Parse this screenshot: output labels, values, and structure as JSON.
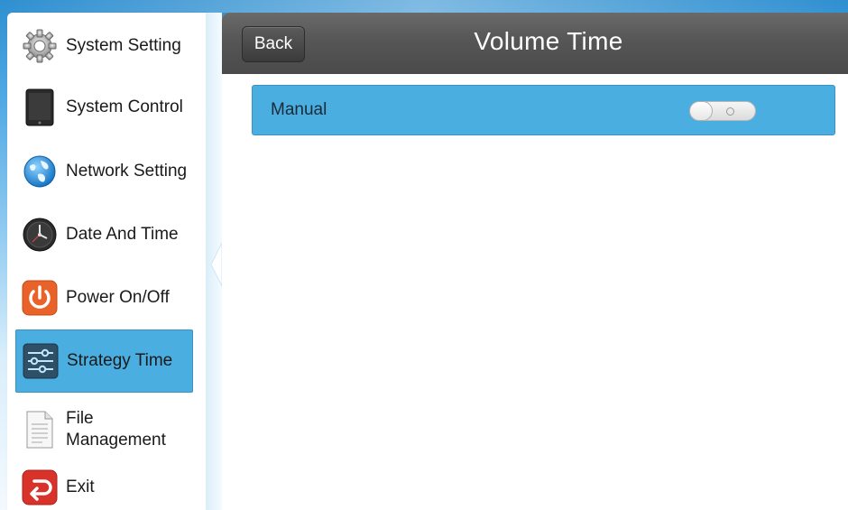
{
  "sidebar": {
    "items": [
      {
        "label": "System Setting",
        "icon": "gear-icon",
        "active": false
      },
      {
        "label": "System Control",
        "icon": "tablet-icon",
        "active": false
      },
      {
        "label": "Network Setting",
        "icon": "globe-icon",
        "active": false
      },
      {
        "label": "Date And Time",
        "icon": "clock-icon",
        "active": false
      },
      {
        "label": "Power On/Off",
        "icon": "power-icon",
        "active": false
      },
      {
        "label": "Strategy Time",
        "icon": "sliders-icon",
        "active": true
      },
      {
        "label": "File Management",
        "label_lines": [
          "File",
          "Management"
        ],
        "icon": "document-icon",
        "active": false
      },
      {
        "label": "Exit",
        "icon": "exit-icon",
        "active": false
      }
    ]
  },
  "header": {
    "back_label": "Back",
    "title": "Volume Time"
  },
  "settings": {
    "manual": {
      "label": "Manual",
      "enabled": false
    }
  },
  "colors": {
    "accent": "#4aaee0",
    "header_bg": "#565656",
    "power_orange": "#e8622a",
    "exit_red": "#d9322b"
  }
}
